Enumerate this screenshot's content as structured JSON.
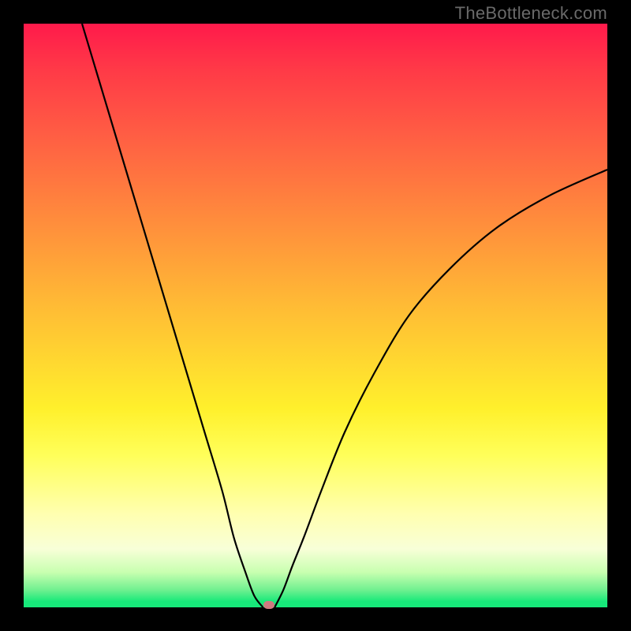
{
  "watermark": "TheBottleneck.com",
  "colors": {
    "curve": "#000000",
    "marker": "#cf7a80",
    "frame": "#000000"
  },
  "chart_data": {
    "type": "line",
    "title": "",
    "xlabel": "",
    "ylabel": "",
    "xlim": [
      0,
      100
    ],
    "ylim": [
      0,
      100
    ],
    "grid": false,
    "series": [
      {
        "name": "left-branch",
        "x": [
          10.0,
          13.0,
          16.0,
          19.0,
          22.0,
          25.0,
          28.0,
          31.0,
          34.0,
          36.0,
          38.0,
          39.5,
          41.0
        ],
        "y": [
          100.0,
          90.0,
          80.0,
          70.0,
          60.0,
          50.0,
          40.0,
          30.0,
          20.0,
          12.0,
          6.0,
          2.0,
          0.0
        ]
      },
      {
        "name": "right-branch",
        "x": [
          43.0,
          44.5,
          46.0,
          48.0,
          51.0,
          55.0,
          60.0,
          66.0,
          73.0,
          81.0,
          90.0,
          100.0
        ],
        "y": [
          0.0,
          3.0,
          7.0,
          12.0,
          20.0,
          30.0,
          40.0,
          50.0,
          58.0,
          65.0,
          70.5,
          75.0
        ]
      }
    ],
    "marker": {
      "x": 42.0,
      "y": 0.0
    },
    "note": "Axes are unlabeled in the source image; x and y are normalized 0–100. The curve is a V-shaped bottleneck profile with minimum near x≈42."
  }
}
